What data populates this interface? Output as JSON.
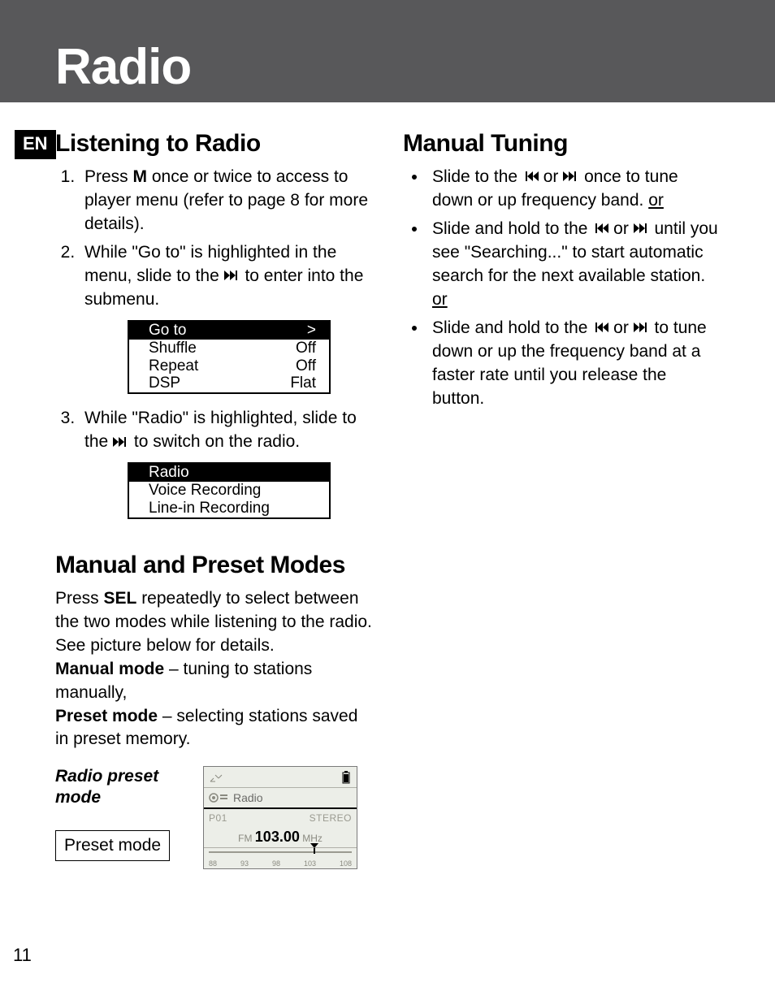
{
  "page": {
    "title": "Radio",
    "lang_badge": "EN",
    "page_number": "11"
  },
  "left": {
    "h_listening": "Listening to Radio",
    "steps": {
      "s1_a": "Press ",
      "s1_key": "M",
      "s1_b": " once or twice to access to player menu (refer to page 8 for more details).",
      "s2_a": "While \"Go to\" is highlighted in the menu, slide to the ",
      "s2_b": " to enter into the submenu.",
      "s3_a": "While \"Radio\" is highlighted, slide to the ",
      "s3_b": " to switch on the radio."
    },
    "menu1": [
      {
        "k": "Go to",
        "v": ">",
        "sel": true
      },
      {
        "k": "Shuffle",
        "v": "Off"
      },
      {
        "k": "Repeat",
        "v": "Off"
      },
      {
        "k": "DSP",
        "v": "Flat"
      }
    ],
    "menu2": [
      {
        "k": "Radio",
        "v": "",
        "sel": true
      },
      {
        "k": "Voice Recording",
        "v": ""
      },
      {
        "k": "Line-in Recording",
        "v": ""
      }
    ],
    "h_modes": "Manual and Preset Modes",
    "modes_p1_a": "Press ",
    "modes_p1_key": "SEL",
    "modes_p1_b": " repeatedly to select between the two modes while listening to the radio. See picture below for details.",
    "modes_p2_key": "Manual mode",
    "modes_p2_b": " – tuning to stations manually,",
    "modes_p3_key": "Preset mode",
    "modes_p3_b": " – selecting stations saved in preset memory.",
    "preset_caption": "Radio preset mode",
    "preset_label": "Preset mode"
  },
  "right": {
    "h_manual": "Manual Tuning",
    "b1_a": "Slide to the ",
    "b1_b": " or ",
    "b1_c": " once to tune down or up frequency band. ",
    "b1_or": "or",
    "b2_a": "Slide and hold to the ",
    "b2_b": " or ",
    "b2_c": " until you see \"Searching...\" to start automatic search for the next available station. ",
    "b2_or": "or",
    "b3_a": "Slide and hold to the ",
    "b3_b": " or ",
    "b3_c": " to tune down or up the frequency band at a faster rate until you release the button."
  },
  "lcd": {
    "label": "Radio",
    "preset": "P01",
    "stereo": "STEREO",
    "fm": "FM",
    "freq": "103.00",
    "unit": "MHz",
    "scale": [
      "88",
      "93",
      "98",
      "103",
      "108"
    ]
  }
}
